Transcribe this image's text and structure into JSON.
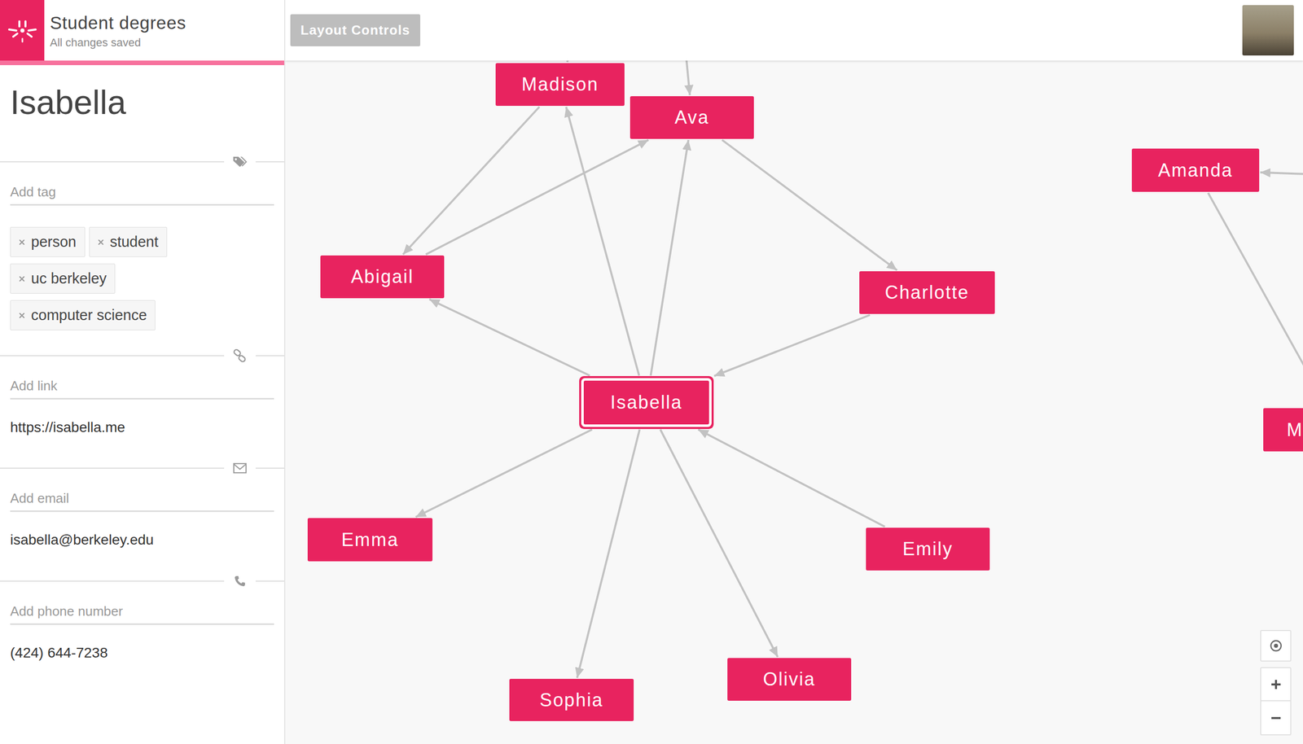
{
  "app": {
    "title": "Student degrees",
    "save_status": "All changes saved"
  },
  "toolbar": {
    "layout_button": "Layout Controls"
  },
  "panel": {
    "name": "Isabella",
    "tag_placeholder": "Add tag",
    "tags": [
      "person",
      "student",
      "uc berkeley",
      "computer science"
    ],
    "link_placeholder": "Add link",
    "link": "https://isabella.me",
    "email_placeholder": "Add email",
    "email": "isabella@berkeley.edu",
    "phone_placeholder": "Add phone number",
    "phone": "(424) 644-7238"
  },
  "graph": {
    "nodes": [
      {
        "label": "Madison",
        "selected": false
      },
      {
        "label": "Ava",
        "selected": false
      },
      {
        "label": "Amanda",
        "selected": false
      },
      {
        "label": "Abigail",
        "selected": false
      },
      {
        "label": "Charlotte",
        "selected": false
      },
      {
        "label": "Isabella",
        "selected": true
      },
      {
        "label": "Emma",
        "selected": false
      },
      {
        "label": "Emily",
        "selected": false
      },
      {
        "label": "Olivia",
        "selected": false
      },
      {
        "label": "Sophia",
        "selected": false
      },
      {
        "label": "M",
        "selected": false
      }
    ],
    "edges": [
      {
        "from": 5,
        "to": 3
      },
      {
        "from": 5,
        "to": 0
      },
      {
        "from": 5,
        "to": 1
      },
      {
        "from": 4,
        "to": 5
      },
      {
        "from": 5,
        "to": 6
      },
      {
        "from": 7,
        "to": 5
      },
      {
        "from": 5,
        "to": 8
      },
      {
        "from": 5,
        "to": 9
      },
      {
        "from": 0,
        "to": 3
      },
      {
        "from": 3,
        "to": 1
      },
      {
        "from": 1,
        "to": 4
      },
      {
        "from": 2,
        "to": 10
      },
      {
        "from": null,
        "to": 1
      },
      {
        "from": null,
        "to": 0
      },
      {
        "from": null,
        "to": 2
      }
    ]
  }
}
